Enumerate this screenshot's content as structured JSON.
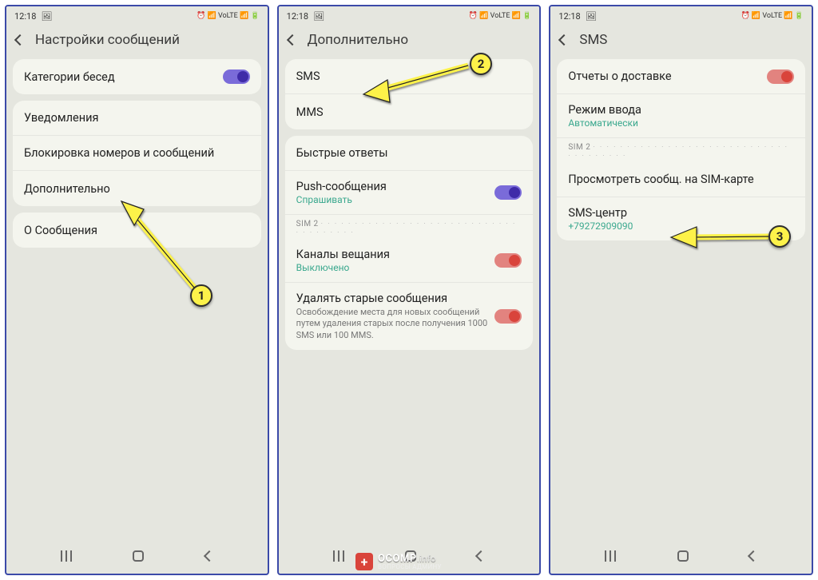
{
  "status": {
    "time": "12:18",
    "icons_text": "⏰ 📶 VoLTE 📶 🔋"
  },
  "screens": [
    {
      "title": "Настройки сообщений",
      "cards": [
        {
          "rows": [
            {
              "label": "Категории бесед",
              "toggle": "on-purple"
            }
          ]
        },
        {
          "rows": [
            {
              "label": "Уведомления"
            },
            {
              "label": "Блокировка номеров и сообщений"
            },
            {
              "label": "Дополнительно"
            }
          ]
        },
        {
          "rows": [
            {
              "label": "О Сообщения"
            }
          ]
        }
      ]
    },
    {
      "title": "Дополнительно",
      "cards": [
        {
          "rows": [
            {
              "label": "SMS"
            },
            {
              "label": "MMS"
            }
          ]
        },
        {
          "rows": [
            {
              "label": "Быстрые ответы"
            },
            {
              "label": "Push-сообщения",
              "sub": "Спрашивать",
              "toggle": "on-purple"
            },
            {
              "sim": "SIM 2"
            },
            {
              "label": "Каналы вещания",
              "sub": "Выключено",
              "toggle": "on-red"
            },
            {
              "label": "Удалять старые сообщения",
              "desc": "Освобождение места для новых сообщений путем удаления старых после получения 1000 SMS или 100 MMS.",
              "toggle": "on-red"
            }
          ]
        }
      ]
    },
    {
      "title": "SMS",
      "cards": [
        {
          "rows": [
            {
              "label": "Отчеты о доставке",
              "toggle": "on-red"
            },
            {
              "label": "Режим ввода",
              "sub": "Автоматически"
            },
            {
              "sim": "SIM 2"
            },
            {
              "label": "Просмотреть сообщ. на SIM-карте"
            },
            {
              "label": "SMS-центр",
              "sub": "+79272909090"
            }
          ]
        }
      ]
    }
  ],
  "badges": {
    "b1": "1",
    "b2": "2",
    "b3": "3"
  },
  "watermark": {
    "plus": "+",
    "brand": "OCOMP",
    "suffix": ".info",
    "sub": "ВОПРОСЫ АДМИНУ"
  }
}
